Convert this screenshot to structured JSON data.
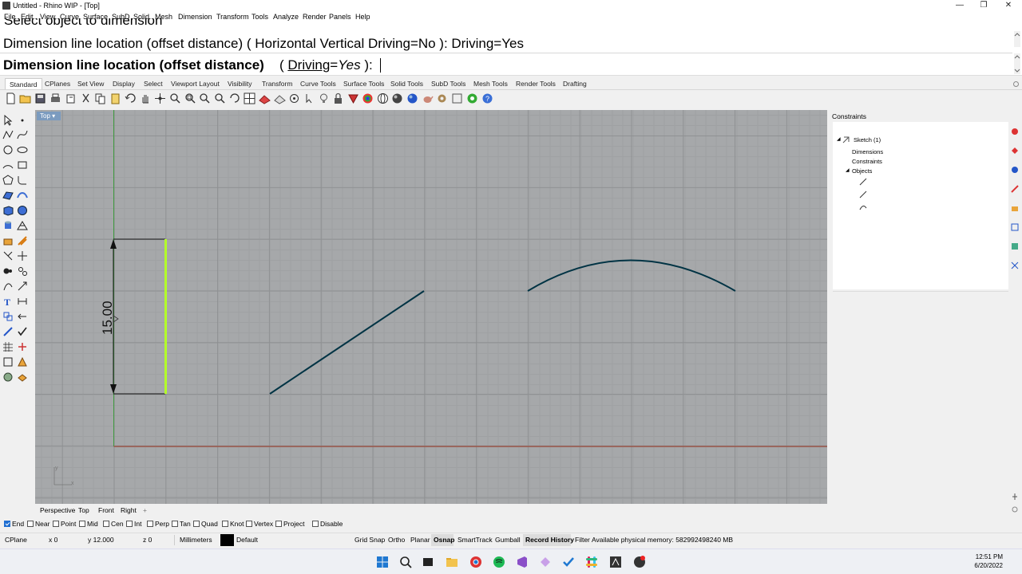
{
  "window": {
    "title": "Untitled - Rhino WIP - [Top]",
    "buttons": [
      "—",
      "❐",
      "✕"
    ]
  },
  "menu": [
    "File",
    "Edit",
    "View",
    "Curve",
    "Surface",
    "SubD",
    "Solid",
    "Mesh",
    "Dimension",
    "Transform",
    "Tools",
    "Analyze",
    "Render",
    "Panels",
    "Help"
  ],
  "command": {
    "history0": "Select object to dimension",
    "history1": "Dimension line location (offset distance) ( Horizontal  Vertical  Driving=No ): Driving=Yes",
    "prompt_bold": "Dimension line location (offset distance)",
    "prompt_open": "( ",
    "prompt_option": "Driving",
    "prompt_eq": "=",
    "prompt_value": "Yes",
    "prompt_close": " ):"
  },
  "toolbar_tabs": [
    "Standard",
    "CPlanes",
    "Set View",
    "Display",
    "Select",
    "Viewport Layout",
    "Visibility",
    "Transform",
    "Curve Tools",
    "Surface Tools",
    "Solid Tools",
    "SubD Tools",
    "Mesh Tools",
    "Render Tools",
    "Drafting"
  ],
  "viewport": {
    "label": "Top",
    "dimension_text": "15.00",
    "axis_y": "y",
    "axis_x": "x"
  },
  "viewport_tabs": [
    "Perspective",
    "Top",
    "Front",
    "Right",
    "+"
  ],
  "osnap": [
    {
      "label": "End",
      "checked": true
    },
    {
      "label": "Near",
      "checked": false
    },
    {
      "label": "Point",
      "checked": false
    },
    {
      "label": "Mid",
      "checked": false
    },
    {
      "label": "Cen",
      "checked": false
    },
    {
      "label": "Int",
      "checked": false
    },
    {
      "label": "Perp",
      "checked": false
    },
    {
      "label": "Tan",
      "checked": false
    },
    {
      "label": "Quad",
      "checked": false
    },
    {
      "label": "Knot",
      "checked": false
    },
    {
      "label": "Vertex",
      "checked": false
    },
    {
      "label": "Project",
      "checked": false
    },
    {
      "label": "Disable",
      "checked": false
    }
  ],
  "status": {
    "cplane": "CPlane",
    "x": "x 0",
    "y": "y 12.000",
    "z": "z 0",
    "units": "Millimeters",
    "layer": "Default",
    "grid_snap": "Grid Snap",
    "ortho": "Ortho",
    "planar": "Planar",
    "osnap": "Osnap",
    "smarttrack": "SmartTrack",
    "gumball": "Gumball",
    "record_history": "Record History",
    "filter": "Filter",
    "memory": "Available physical memory: 582992498240 MB"
  },
  "panel": {
    "title": "Constraints",
    "sketch": "Sketch (1)",
    "dimensions": "Dimensions",
    "constraints": "Constraints",
    "objects": "Objects"
  },
  "clock": {
    "time": "12:51 PM",
    "date": "6/20/2022"
  },
  "colors": {
    "viewport_bg": "#a6a8aa",
    "curve": "#003344",
    "highlight": "#b4ff28",
    "x_axis": "#8a2d2d",
    "y_axis": "#2d8a2d"
  }
}
